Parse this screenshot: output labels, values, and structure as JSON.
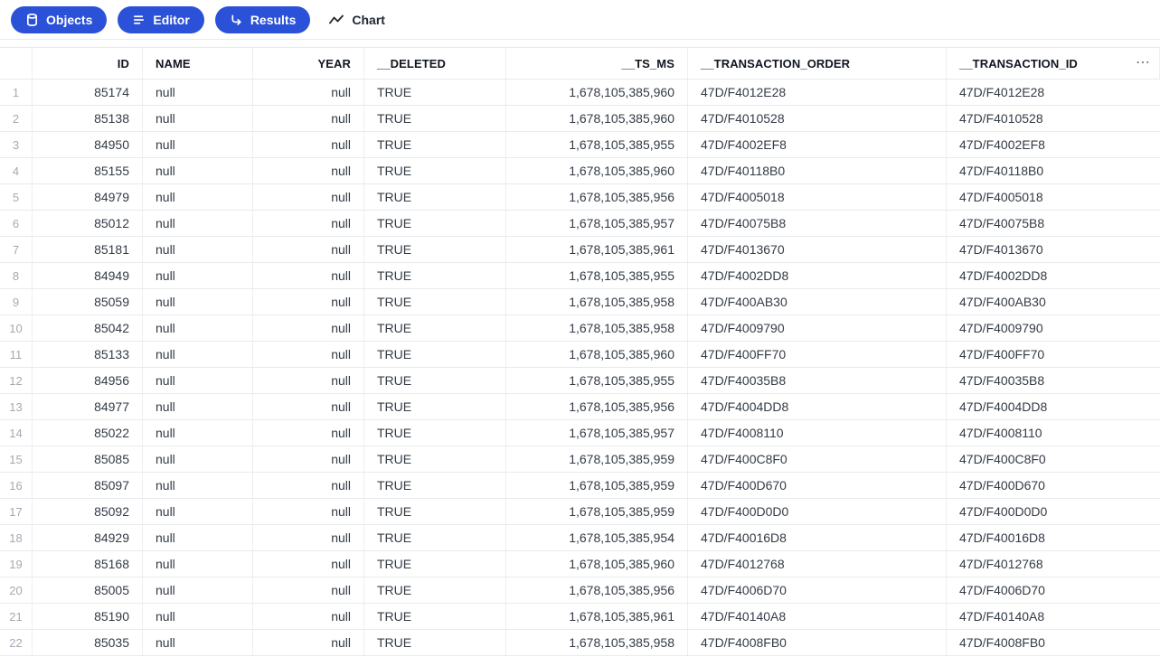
{
  "toolbar": {
    "buttons": [
      {
        "label": "Objects",
        "icon": "database-icon"
      },
      {
        "label": "Editor",
        "icon": "align-left-icon"
      },
      {
        "label": "Results",
        "icon": "corner-down-right-icon"
      }
    ],
    "chart_label": "Chart",
    "chart_icon": "trend-line-icon"
  },
  "colors": {
    "accent_blue": "#2b51d8",
    "border": "#e7e9ec",
    "header_text": "#10161f",
    "cell_text": "#333b46",
    "row_number_text": "#a3a9b3"
  },
  "table": {
    "menu_icon": "ellipsis-icon",
    "menu_glyph": "⋯",
    "columns": [
      {
        "key": "row",
        "label": "",
        "align": "center"
      },
      {
        "key": "id",
        "label": "ID",
        "align": "right"
      },
      {
        "key": "name",
        "label": "NAME",
        "align": "left"
      },
      {
        "key": "year",
        "label": "YEAR",
        "align": "right"
      },
      {
        "key": "deleted",
        "label": "__DELETED",
        "align": "left"
      },
      {
        "key": "ts_ms",
        "label": "__TS_MS",
        "align": "right"
      },
      {
        "key": "transaction_order",
        "label": "__TRANSACTION_ORDER",
        "align": "left"
      },
      {
        "key": "transaction_id",
        "label": "__TRANSACTION_ID",
        "align": "left"
      }
    ],
    "rows": [
      {
        "row": "1",
        "id": "85174",
        "name": "null",
        "year": "null",
        "deleted": "TRUE",
        "ts_ms": "1,678,105,385,960",
        "transaction_order": "47D/F4012E28",
        "transaction_id": "47D/F4012E28"
      },
      {
        "row": "2",
        "id": "85138",
        "name": "null",
        "year": "null",
        "deleted": "TRUE",
        "ts_ms": "1,678,105,385,960",
        "transaction_order": "47D/F4010528",
        "transaction_id": "47D/F4010528"
      },
      {
        "row": "3",
        "id": "84950",
        "name": "null",
        "year": "null",
        "deleted": "TRUE",
        "ts_ms": "1,678,105,385,955",
        "transaction_order": "47D/F4002EF8",
        "transaction_id": "47D/F4002EF8"
      },
      {
        "row": "4",
        "id": "85155",
        "name": "null",
        "year": "null",
        "deleted": "TRUE",
        "ts_ms": "1,678,105,385,960",
        "transaction_order": "47D/F40118B0",
        "transaction_id": "47D/F40118B0"
      },
      {
        "row": "5",
        "id": "84979",
        "name": "null",
        "year": "null",
        "deleted": "TRUE",
        "ts_ms": "1,678,105,385,956",
        "transaction_order": "47D/F4005018",
        "transaction_id": "47D/F4005018"
      },
      {
        "row": "6",
        "id": "85012",
        "name": "null",
        "year": "null",
        "deleted": "TRUE",
        "ts_ms": "1,678,105,385,957",
        "transaction_order": "47D/F40075B8",
        "transaction_id": "47D/F40075B8"
      },
      {
        "row": "7",
        "id": "85181",
        "name": "null",
        "year": "null",
        "deleted": "TRUE",
        "ts_ms": "1,678,105,385,961",
        "transaction_order": "47D/F4013670",
        "transaction_id": "47D/F4013670"
      },
      {
        "row": "8",
        "id": "84949",
        "name": "null",
        "year": "null",
        "deleted": "TRUE",
        "ts_ms": "1,678,105,385,955",
        "transaction_order": "47D/F4002DD8",
        "transaction_id": "47D/F4002DD8"
      },
      {
        "row": "9",
        "id": "85059",
        "name": "null",
        "year": "null",
        "deleted": "TRUE",
        "ts_ms": "1,678,105,385,958",
        "transaction_order": "47D/F400AB30",
        "transaction_id": "47D/F400AB30"
      },
      {
        "row": "10",
        "id": "85042",
        "name": "null",
        "year": "null",
        "deleted": "TRUE",
        "ts_ms": "1,678,105,385,958",
        "transaction_order": "47D/F4009790",
        "transaction_id": "47D/F4009790"
      },
      {
        "row": "11",
        "id": "85133",
        "name": "null",
        "year": "null",
        "deleted": "TRUE",
        "ts_ms": "1,678,105,385,960",
        "transaction_order": "47D/F400FF70",
        "transaction_id": "47D/F400FF70"
      },
      {
        "row": "12",
        "id": "84956",
        "name": "null",
        "year": "null",
        "deleted": "TRUE",
        "ts_ms": "1,678,105,385,955",
        "transaction_order": "47D/F40035B8",
        "transaction_id": "47D/F40035B8"
      },
      {
        "row": "13",
        "id": "84977",
        "name": "null",
        "year": "null",
        "deleted": "TRUE",
        "ts_ms": "1,678,105,385,956",
        "transaction_order": "47D/F4004DD8",
        "transaction_id": "47D/F4004DD8"
      },
      {
        "row": "14",
        "id": "85022",
        "name": "null",
        "year": "null",
        "deleted": "TRUE",
        "ts_ms": "1,678,105,385,957",
        "transaction_order": "47D/F4008110",
        "transaction_id": "47D/F4008110"
      },
      {
        "row": "15",
        "id": "85085",
        "name": "null",
        "year": "null",
        "deleted": "TRUE",
        "ts_ms": "1,678,105,385,959",
        "transaction_order": "47D/F400C8F0",
        "transaction_id": "47D/F400C8F0"
      },
      {
        "row": "16",
        "id": "85097",
        "name": "null",
        "year": "null",
        "deleted": "TRUE",
        "ts_ms": "1,678,105,385,959",
        "transaction_order": "47D/F400D670",
        "transaction_id": "47D/F400D670"
      },
      {
        "row": "17",
        "id": "85092",
        "name": "null",
        "year": "null",
        "deleted": "TRUE",
        "ts_ms": "1,678,105,385,959",
        "transaction_order": "47D/F400D0D0",
        "transaction_id": "47D/F400D0D0"
      },
      {
        "row": "18",
        "id": "84929",
        "name": "null",
        "year": "null",
        "deleted": "TRUE",
        "ts_ms": "1,678,105,385,954",
        "transaction_order": "47D/F40016D8",
        "transaction_id": "47D/F40016D8"
      },
      {
        "row": "19",
        "id": "85168",
        "name": "null",
        "year": "null",
        "deleted": "TRUE",
        "ts_ms": "1,678,105,385,960",
        "transaction_order": "47D/F4012768",
        "transaction_id": "47D/F4012768"
      },
      {
        "row": "20",
        "id": "85005",
        "name": "null",
        "year": "null",
        "deleted": "TRUE",
        "ts_ms": "1,678,105,385,956",
        "transaction_order": "47D/F4006D70",
        "transaction_id": "47D/F4006D70"
      },
      {
        "row": "21",
        "id": "85190",
        "name": "null",
        "year": "null",
        "deleted": "TRUE",
        "ts_ms": "1,678,105,385,961",
        "transaction_order": "47D/F40140A8",
        "transaction_id": "47D/F40140A8"
      },
      {
        "row": "22",
        "id": "85035",
        "name": "null",
        "year": "null",
        "deleted": "TRUE",
        "ts_ms": "1,678,105,385,958",
        "transaction_order": "47D/F4008FB0",
        "transaction_id": "47D/F4008FB0"
      }
    ]
  }
}
